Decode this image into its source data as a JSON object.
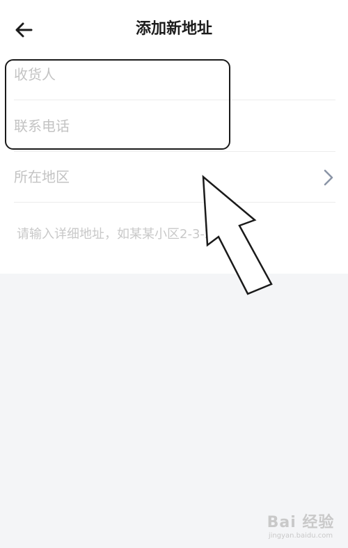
{
  "header": {
    "title": "添加新地址",
    "back_icon": "arrow-left-icon"
  },
  "form": {
    "name_placeholder": "收货人",
    "phone_placeholder": "联系电话",
    "region_placeholder": "所在地区",
    "region_icon": "chevron-right-icon",
    "detail_placeholder": "请输入详细地址，如某某小区2-3-203"
  },
  "annotation": {
    "box_color": "#1a1a1a",
    "arrow_color": "#1a1a1a"
  },
  "watermark": {
    "brand": "Bai 经验",
    "site": "jingyan.baidu.com"
  },
  "colors": {
    "placeholder": "#c3c3c3",
    "background": "#f4f5f7",
    "chevron": "#8a94a6"
  }
}
